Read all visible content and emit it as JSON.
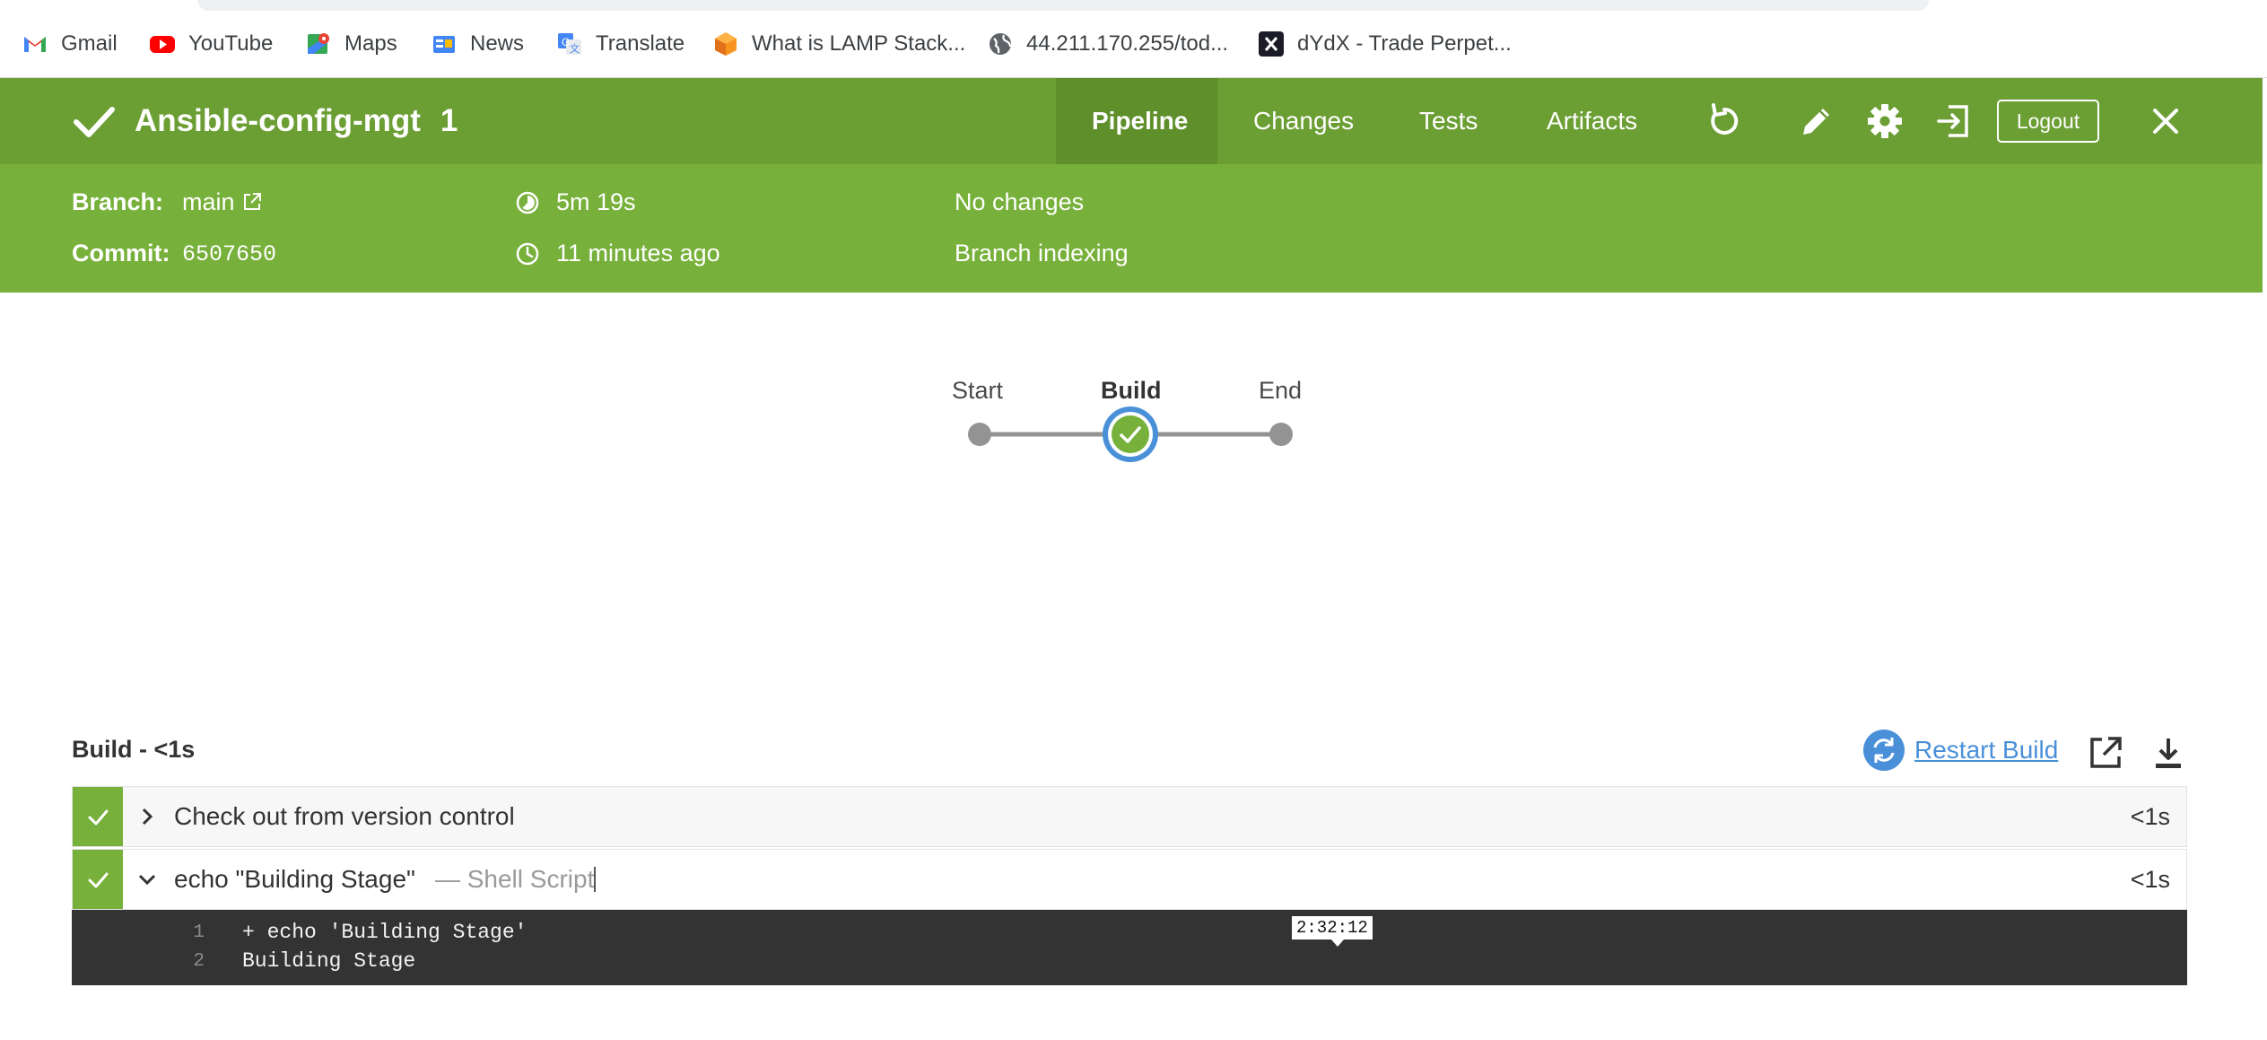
{
  "bookmarks": [
    {
      "label": "Gmail",
      "icon": "gmail-icon"
    },
    {
      "label": "YouTube",
      "icon": "youtube-icon"
    },
    {
      "label": "Maps",
      "icon": "maps-icon"
    },
    {
      "label": "News",
      "icon": "news-icon"
    },
    {
      "label": "Translate",
      "icon": "translate-icon"
    },
    {
      "label": "What is LAMP Stack...",
      "icon": "lamp-icon"
    },
    {
      "label": "44.211.170.255/tod...",
      "icon": "globe-icon"
    },
    {
      "label": "dYdX - Trade Perpet...",
      "icon": "dydx-icon"
    }
  ],
  "header": {
    "job_name": "Ansible-config-mgt",
    "run_number": "1",
    "tabs": [
      "Pipeline",
      "Changes",
      "Tests",
      "Artifacts"
    ],
    "active_tab": "Pipeline",
    "logout_label": "Logout"
  },
  "run_info": {
    "branch_label": "Branch:",
    "branch_value": "main",
    "commit_label": "Commit:",
    "commit_value": "6507650",
    "duration": "5m 19s",
    "started": "11 minutes ago",
    "changes": "No changes",
    "cause": "Branch indexing"
  },
  "pipeline": {
    "stages": [
      "Start",
      "Build",
      "End"
    ],
    "selected_stage": "Build"
  },
  "steps_panel": {
    "title": "Build - <1s",
    "restart_label": "Restart Build",
    "steps": [
      {
        "label": "Check out from version control",
        "sub": "",
        "duration": "<1s",
        "expanded": false
      },
      {
        "label": "echo \"Building Stage\"",
        "sub": "— Shell Script",
        "duration": "<1s",
        "expanded": true
      }
    ],
    "console": [
      {
        "n": "1",
        "text": "+ echo 'Building Stage'"
      },
      {
        "n": "2",
        "text": "Building Stage"
      }
    ],
    "tooltip": "2:32:12"
  },
  "colors": {
    "topbar": "#6b9e33",
    "infobar": "#77b03a",
    "success": "#77b03a",
    "link": "#4a90d9",
    "console_bg": "#333333"
  }
}
